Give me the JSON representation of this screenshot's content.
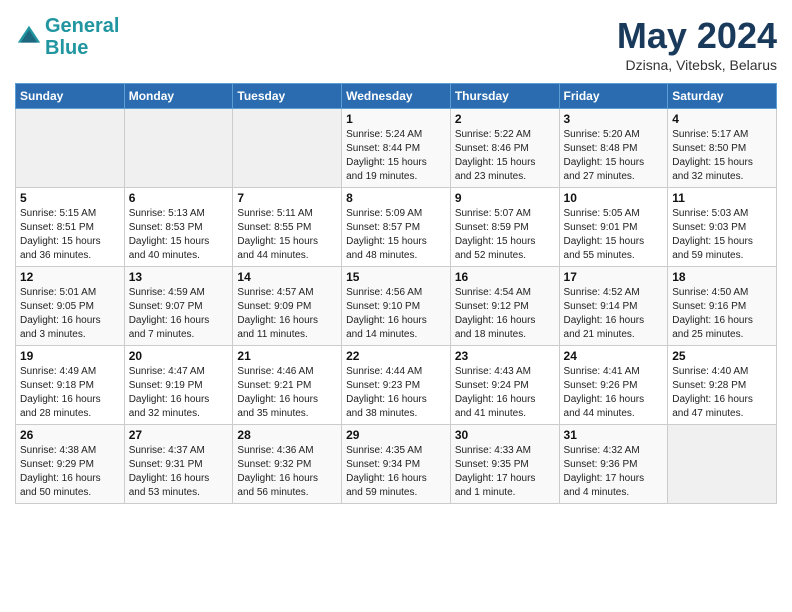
{
  "header": {
    "logo_line1": "General",
    "logo_line2": "Blue",
    "month": "May 2024",
    "location": "Dzisna, Vitebsk, Belarus"
  },
  "weekdays": [
    "Sunday",
    "Monday",
    "Tuesday",
    "Wednesday",
    "Thursday",
    "Friday",
    "Saturday"
  ],
  "weeks": [
    [
      {
        "day": "",
        "info": ""
      },
      {
        "day": "",
        "info": ""
      },
      {
        "day": "",
        "info": ""
      },
      {
        "day": "1",
        "info": "Sunrise: 5:24 AM\nSunset: 8:44 PM\nDaylight: 15 hours\nand 19 minutes."
      },
      {
        "day": "2",
        "info": "Sunrise: 5:22 AM\nSunset: 8:46 PM\nDaylight: 15 hours\nand 23 minutes."
      },
      {
        "day": "3",
        "info": "Sunrise: 5:20 AM\nSunset: 8:48 PM\nDaylight: 15 hours\nand 27 minutes."
      },
      {
        "day": "4",
        "info": "Sunrise: 5:17 AM\nSunset: 8:50 PM\nDaylight: 15 hours\nand 32 minutes."
      }
    ],
    [
      {
        "day": "5",
        "info": "Sunrise: 5:15 AM\nSunset: 8:51 PM\nDaylight: 15 hours\nand 36 minutes."
      },
      {
        "day": "6",
        "info": "Sunrise: 5:13 AM\nSunset: 8:53 PM\nDaylight: 15 hours\nand 40 minutes."
      },
      {
        "day": "7",
        "info": "Sunrise: 5:11 AM\nSunset: 8:55 PM\nDaylight: 15 hours\nand 44 minutes."
      },
      {
        "day": "8",
        "info": "Sunrise: 5:09 AM\nSunset: 8:57 PM\nDaylight: 15 hours\nand 48 minutes."
      },
      {
        "day": "9",
        "info": "Sunrise: 5:07 AM\nSunset: 8:59 PM\nDaylight: 15 hours\nand 52 minutes."
      },
      {
        "day": "10",
        "info": "Sunrise: 5:05 AM\nSunset: 9:01 PM\nDaylight: 15 hours\nand 55 minutes."
      },
      {
        "day": "11",
        "info": "Sunrise: 5:03 AM\nSunset: 9:03 PM\nDaylight: 15 hours\nand 59 minutes."
      }
    ],
    [
      {
        "day": "12",
        "info": "Sunrise: 5:01 AM\nSunset: 9:05 PM\nDaylight: 16 hours\nand 3 minutes."
      },
      {
        "day": "13",
        "info": "Sunrise: 4:59 AM\nSunset: 9:07 PM\nDaylight: 16 hours\nand 7 minutes."
      },
      {
        "day": "14",
        "info": "Sunrise: 4:57 AM\nSunset: 9:09 PM\nDaylight: 16 hours\nand 11 minutes."
      },
      {
        "day": "15",
        "info": "Sunrise: 4:56 AM\nSunset: 9:10 PM\nDaylight: 16 hours\nand 14 minutes."
      },
      {
        "day": "16",
        "info": "Sunrise: 4:54 AM\nSunset: 9:12 PM\nDaylight: 16 hours\nand 18 minutes."
      },
      {
        "day": "17",
        "info": "Sunrise: 4:52 AM\nSunset: 9:14 PM\nDaylight: 16 hours\nand 21 minutes."
      },
      {
        "day": "18",
        "info": "Sunrise: 4:50 AM\nSunset: 9:16 PM\nDaylight: 16 hours\nand 25 minutes."
      }
    ],
    [
      {
        "day": "19",
        "info": "Sunrise: 4:49 AM\nSunset: 9:18 PM\nDaylight: 16 hours\nand 28 minutes."
      },
      {
        "day": "20",
        "info": "Sunrise: 4:47 AM\nSunset: 9:19 PM\nDaylight: 16 hours\nand 32 minutes."
      },
      {
        "day": "21",
        "info": "Sunrise: 4:46 AM\nSunset: 9:21 PM\nDaylight: 16 hours\nand 35 minutes."
      },
      {
        "day": "22",
        "info": "Sunrise: 4:44 AM\nSunset: 9:23 PM\nDaylight: 16 hours\nand 38 minutes."
      },
      {
        "day": "23",
        "info": "Sunrise: 4:43 AM\nSunset: 9:24 PM\nDaylight: 16 hours\nand 41 minutes."
      },
      {
        "day": "24",
        "info": "Sunrise: 4:41 AM\nSunset: 9:26 PM\nDaylight: 16 hours\nand 44 minutes."
      },
      {
        "day": "25",
        "info": "Sunrise: 4:40 AM\nSunset: 9:28 PM\nDaylight: 16 hours\nand 47 minutes."
      }
    ],
    [
      {
        "day": "26",
        "info": "Sunrise: 4:38 AM\nSunset: 9:29 PM\nDaylight: 16 hours\nand 50 minutes."
      },
      {
        "day": "27",
        "info": "Sunrise: 4:37 AM\nSunset: 9:31 PM\nDaylight: 16 hours\nand 53 minutes."
      },
      {
        "day": "28",
        "info": "Sunrise: 4:36 AM\nSunset: 9:32 PM\nDaylight: 16 hours\nand 56 minutes."
      },
      {
        "day": "29",
        "info": "Sunrise: 4:35 AM\nSunset: 9:34 PM\nDaylight: 16 hours\nand 59 minutes."
      },
      {
        "day": "30",
        "info": "Sunrise: 4:33 AM\nSunset: 9:35 PM\nDaylight: 17 hours\nand 1 minute."
      },
      {
        "day": "31",
        "info": "Sunrise: 4:32 AM\nSunset: 9:36 PM\nDaylight: 17 hours\nand 4 minutes."
      },
      {
        "day": "",
        "info": ""
      }
    ]
  ]
}
